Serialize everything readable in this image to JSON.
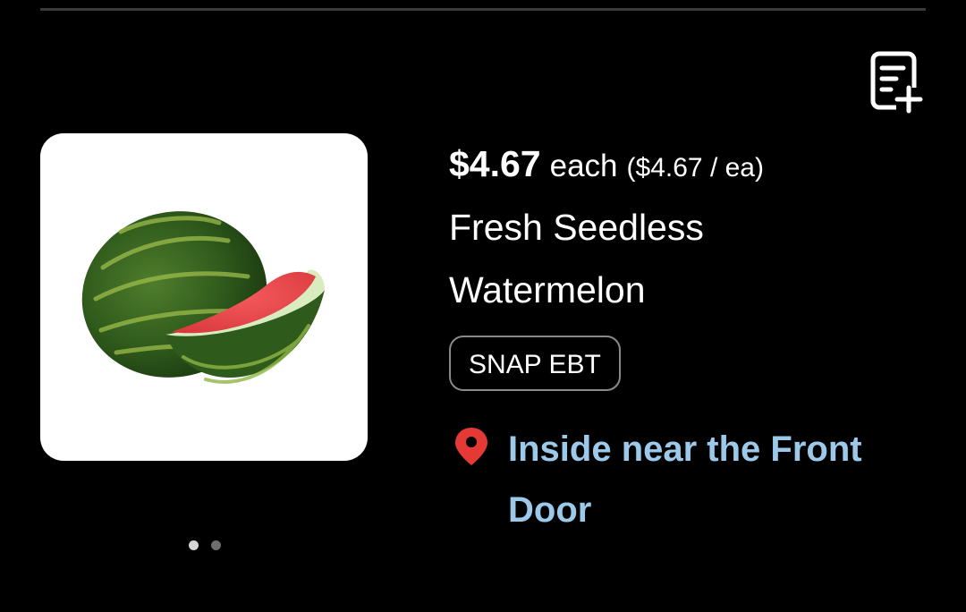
{
  "product": {
    "price": "$4.67",
    "unit": "each",
    "unit_price": "($4.67 / ea)",
    "name": "Fresh Seedless Watermelon",
    "badge": "SNAP EBT",
    "location": "Inside near the Front Door"
  },
  "gallery": {
    "image_count": 2,
    "active_index": 0
  },
  "icons": {
    "add_to_list": "list-add-icon",
    "location": "map-pin-icon"
  },
  "colors": {
    "background": "#000000",
    "location_text": "#9cc8ea",
    "pin": "#e53935"
  }
}
